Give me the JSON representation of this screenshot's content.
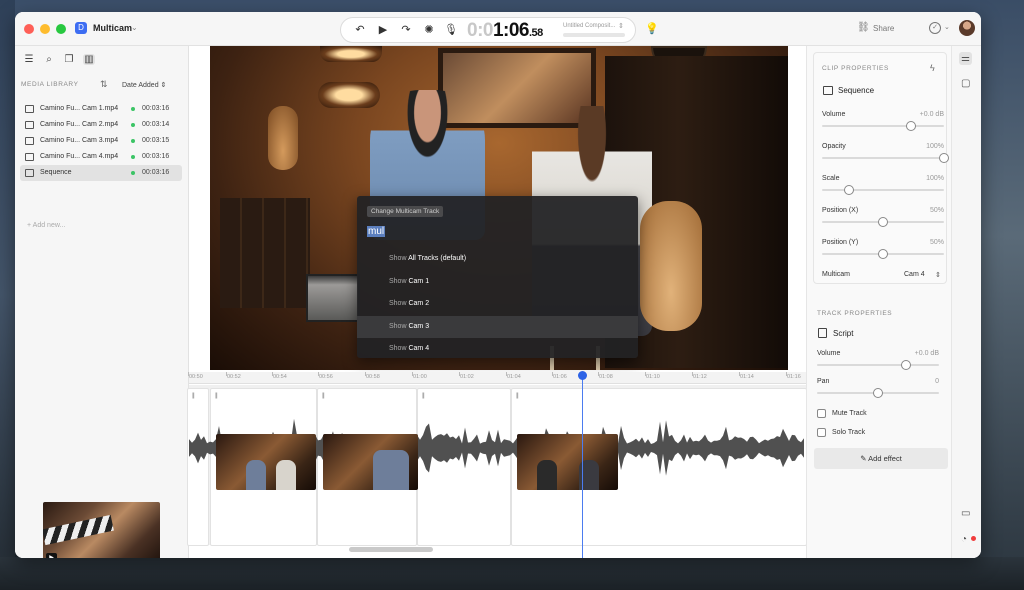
{
  "app": {
    "title": "Multicam"
  },
  "transport": {
    "timecode_dim": "0:0",
    "timecode_main": "1:06",
    "timecode_frames": ".58",
    "composition": "Untitled Composit..."
  },
  "header": {
    "share_label": "Share"
  },
  "sidebar": {
    "section_label": "MEDIA LIBRARY",
    "sort_label": "Date Added",
    "items": [
      {
        "name": "Camino Fu... Cam 1.mp4",
        "duration": "00:03:16",
        "selected": false
      },
      {
        "name": "Camino Fu... Cam 2.mp4",
        "duration": "00:03:14",
        "selected": false
      },
      {
        "name": "Camino Fu... Cam 3.mp4",
        "duration": "00:03:15",
        "selected": false
      },
      {
        "name": "Camino Fu... Cam 4.mp4",
        "duration": "00:03:16",
        "selected": false
      },
      {
        "name": "Sequence",
        "duration": "00:03:16",
        "selected": true
      }
    ],
    "add_new": "Add new..."
  },
  "menu": {
    "header": "Change Multicam Track",
    "query": "mul",
    "items": [
      {
        "prefix": "Show",
        "label": "All Tracks (default)",
        "highlighted": false
      },
      {
        "prefix": "Show",
        "label": "Cam 1",
        "highlighted": false
      },
      {
        "prefix": "Show",
        "label": "Cam 2",
        "highlighted": false
      },
      {
        "prefix": "Show",
        "label": "Cam 3",
        "highlighted": true
      },
      {
        "prefix": "Show",
        "label": "Cam 4",
        "highlighted": false
      }
    ]
  },
  "clip_properties": {
    "heading": "CLIP PROPERTIES",
    "name": "Sequence",
    "props": [
      {
        "label": "Volume",
        "value": "+0.0 dB",
        "fraction": 0.73
      },
      {
        "label": "Opacity",
        "value": "100%",
        "fraction": 1.0
      },
      {
        "label": "Scale",
        "value": "100%",
        "fraction": 0.22
      },
      {
        "label": "Position (X)",
        "value": "50%",
        "fraction": 0.5
      },
      {
        "label": "Position (Y)",
        "value": "50%",
        "fraction": 0.5
      }
    ],
    "multicam_label": "Multicam",
    "multicam_value": "Cam 4"
  },
  "track_properties": {
    "heading": "TRACK PROPERTIES",
    "name": "Script",
    "props": [
      {
        "label": "Volume",
        "value": "+0.0 dB",
        "fraction": 0.73
      },
      {
        "label": "Pan",
        "value": "0",
        "fraction": 0.5
      }
    ],
    "mute_label": "Mute Track",
    "solo_label": "Solo Track",
    "add_effect": "Add effect"
  },
  "timeline": {
    "ticks": [
      "00:50",
      "00:52",
      "00:54",
      "00:56",
      "00:58",
      "01:00",
      "01:02",
      "01:04",
      "01:06",
      "01:08",
      "01:10",
      "01:12",
      "01:14",
      "01:16"
    ]
  }
}
